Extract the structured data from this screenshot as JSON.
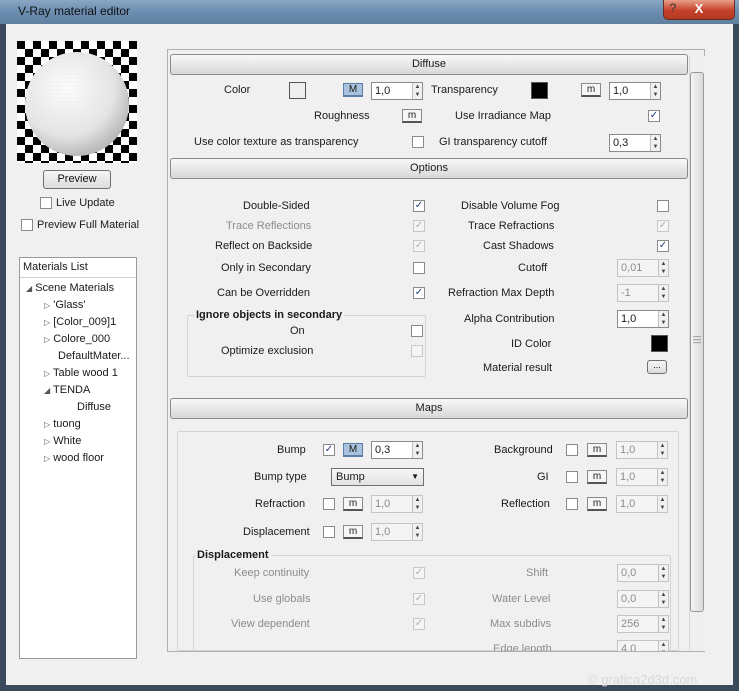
{
  "window": {
    "title": "V-Ray material editor",
    "help": "?",
    "close": "X"
  },
  "preview": {
    "button_label": "Preview",
    "live_update_label": "Live Update",
    "preview_full_label": "Preview Full Material"
  },
  "materials": {
    "header": "Materials List",
    "root": "Scene Materials",
    "items": [
      "'Glass'",
      "[Color_009]1",
      "Colore_000",
      "DefaultMater...",
      "Table wood 1",
      "TENDA",
      "Diffuse",
      "tuong",
      "White",
      "wood floor"
    ]
  },
  "diffuse": {
    "header": "Diffuse",
    "color_label": "Color",
    "color_mbtn": "M",
    "color_value": "1,0",
    "transparency_label": "Transparency",
    "transparency_mbtn": "m",
    "transparency_value": "1,0",
    "roughness_label": "Roughness",
    "roughness_mbtn": "m",
    "irradiance_label": "Use Irradiance Map",
    "color_tex_label": "Use color texture as transparency",
    "gi_cutoff_label": "GI transparency cutoff",
    "gi_cutoff_value": "0,3"
  },
  "options": {
    "header": "Options",
    "double_sided": "Double-Sided",
    "trace_reflections": "Trace Reflections",
    "reflect_backside": "Reflect on Backside",
    "only_secondary": "Only in Secondary",
    "can_be_overridden": "Can be Overridden",
    "ignore_group": "Ignore objects in secondary",
    "on_label": "On",
    "optimize_exclusion": "Optimize exclusion",
    "disable_volume_fog": "Disable Volume Fog",
    "trace_refractions": "Trace Refractions",
    "cast_shadows": "Cast Shadows",
    "cutoff_label": "Cutoff",
    "cutoff_value": "0,01",
    "refraction_depth_label": "Refraction Max Depth",
    "refraction_depth_value": "-1",
    "alpha_label": "Alpha Contribution",
    "alpha_value": "1,0",
    "id_color_label": "ID Color",
    "material_result_label": "Material result",
    "material_result_btn": "..."
  },
  "maps": {
    "header": "Maps",
    "bump_label": "Bump",
    "bump_mbtn": "M",
    "bump_value": "0,3",
    "bump_type_label": "Bump type",
    "bump_type_value": "Bump",
    "refraction_label": "Refraction",
    "refraction_mbtn": "m",
    "refraction_value": "1,0",
    "displacement_label": "Displacement",
    "displacement_mbtn": "m",
    "displacement_value": "1,0",
    "background_label": "Background",
    "background_mbtn": "m",
    "background_value": "1,0",
    "gi_label": "GI",
    "gi_mbtn": "m",
    "gi_value": "1,0",
    "reflection_label": "Reflection",
    "reflection_mbtn": "m",
    "reflection_value": "1,0"
  },
  "displacement": {
    "header": "Displacement",
    "keep_continuity": "Keep continuity",
    "use_globals": "Use globals",
    "view_dependent": "View dependent",
    "shift_label": "Shift",
    "shift_value": "0,0",
    "water_level_label": "Water Level",
    "water_level_value": "0,0",
    "max_subdivs_label": "Max subdivs",
    "max_subdivs_value": "256",
    "edge_length_label": "Edge length",
    "edge_length_value": "4,0"
  },
  "watermark": "© grafica2d3d.com"
}
